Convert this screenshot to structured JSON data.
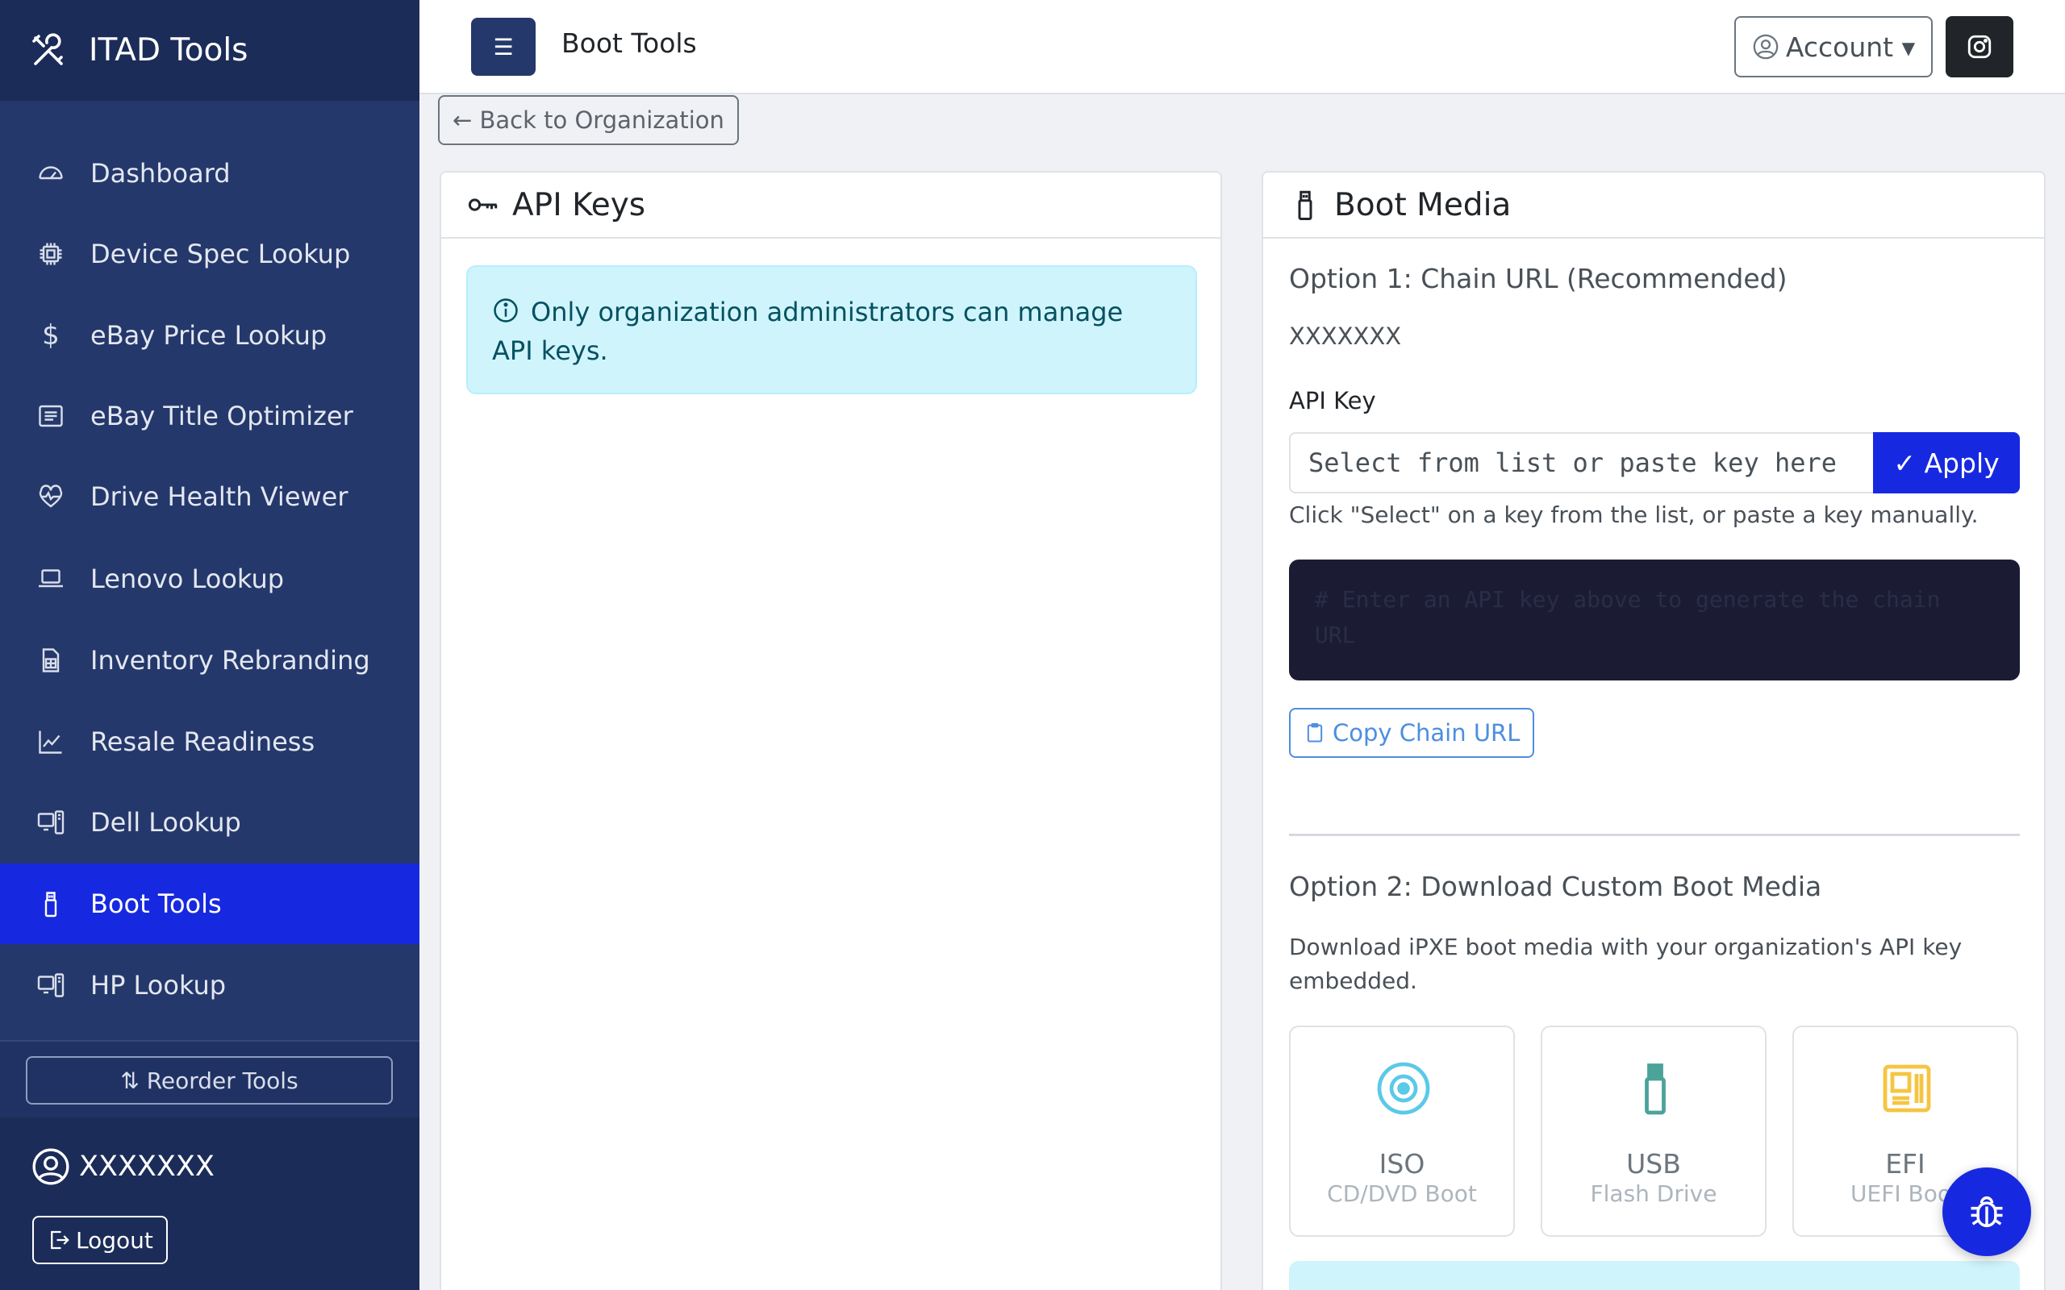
{
  "sidebar": {
    "brand": "ITAD Tools",
    "items": [
      {
        "label": "Dashboard",
        "icon": "speedometer-icon"
      },
      {
        "label": "Device Spec Lookup",
        "icon": "cpu-icon"
      },
      {
        "label": "eBay Price Lookup",
        "icon": "dollar-icon"
      },
      {
        "label": "eBay Title Optimizer",
        "icon": "text-card-icon"
      },
      {
        "label": "Drive Health Viewer",
        "icon": "heart-pulse-icon"
      },
      {
        "label": "Lenovo Lookup",
        "icon": "laptop-icon"
      },
      {
        "label": "Inventory Rebranding",
        "icon": "file-spreadsheet-icon"
      },
      {
        "label": "Resale Readiness",
        "icon": "graph-up-icon"
      },
      {
        "label": "Dell Lookup",
        "icon": "pc-display-icon"
      },
      {
        "label": "Boot Tools",
        "icon": "usb-drive-icon",
        "active": true
      },
      {
        "label": "HP Lookup",
        "icon": "pc-display-icon"
      }
    ],
    "reorder_label": "⇅ Reorder Tools",
    "username": "XXXXXXX",
    "logout_label": "Logout"
  },
  "header": {
    "title": "Boot Tools",
    "account_label": "Account ▾"
  },
  "back_label": "← Back to Organization",
  "api_keys": {
    "title": "API Keys",
    "alert": "Only organization administrators can manage API keys."
  },
  "boot_media": {
    "title": "Boot Media",
    "option1_title": "Option 1: Chain URL (Recommended)",
    "chain_value": "XXXXXXX",
    "api_key_label": "API Key",
    "api_key_placeholder": "Select from list or paste key here",
    "api_key_value": "",
    "apply_label": "✓ Apply",
    "hint": "Click \"Select\" on a key from the list, or paste a key manually.",
    "code_text": "# Enter an API key above to generate the chain URL",
    "copy_label": "Copy Chain URL",
    "option2_title": "Option 2: Download Custom Boot Media",
    "option2_desc": "Download iPXE boot media with your organization's API key embedded.",
    "media": [
      {
        "name": "ISO",
        "sub": "CD/DVD Boot",
        "icon": "disc-icon",
        "color": "#5bc9e8"
      },
      {
        "name": "USB",
        "sub": "Flash Drive",
        "icon": "usb-drive-icon",
        "color": "#4ba39a"
      },
      {
        "name": "EFI",
        "sub": "UEFI Boot",
        "icon": "motherboard-icon",
        "color": "#f5c542"
      }
    ]
  },
  "colors": {
    "sidebar": "#25386b",
    "active": "#1729e0",
    "info_bg": "#cff4fc"
  }
}
